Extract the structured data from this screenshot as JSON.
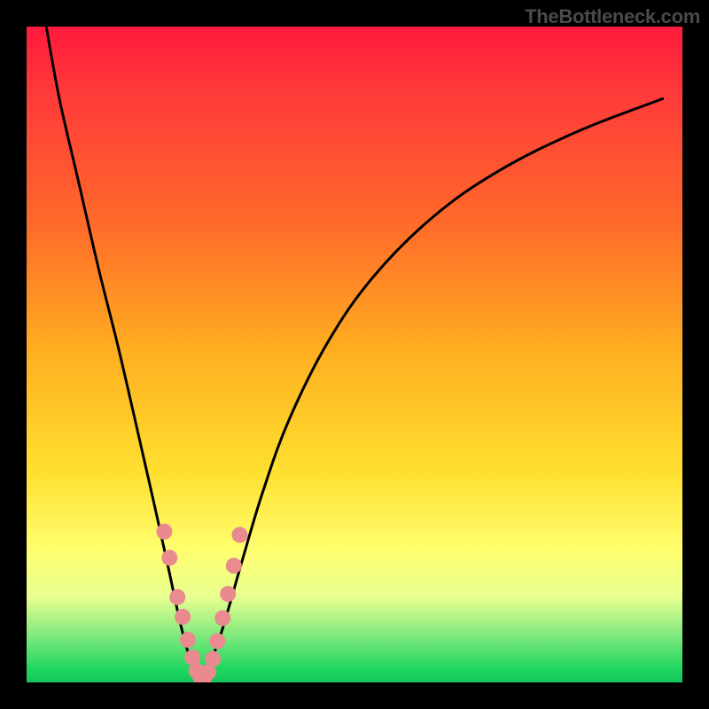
{
  "watermark": "TheBottleneck.com",
  "chart_data": {
    "type": "line",
    "title": "",
    "xlabel": "",
    "ylabel": "",
    "xlim": [
      0,
      100
    ],
    "ylim": [
      0,
      100
    ],
    "grid": false,
    "legend": false,
    "series": [
      {
        "name": "left-branch",
        "x": [
          3,
          5,
          8,
          11,
          14,
          17,
          19.5,
          21.5,
          23,
          24.2,
          25.2,
          26
        ],
        "y": [
          100,
          89,
          76,
          63,
          51,
          38,
          27,
          18,
          11,
          6,
          3,
          1
        ]
      },
      {
        "name": "right-branch",
        "x": [
          27,
          28,
          29.5,
          31,
          33,
          36,
          40,
          46,
          53,
          62,
          72,
          84,
          97
        ],
        "y": [
          1,
          3,
          7,
          12,
          19,
          29,
          40,
          52,
          62,
          71,
          78,
          84,
          89
        ]
      }
    ],
    "scatter_overlay": {
      "name": "highlight-dots",
      "color": "#e98a8f",
      "radius_px": 9,
      "points": [
        {
          "x": 21.0,
          "y": 23
        },
        {
          "x": 21.8,
          "y": 19
        },
        {
          "x": 23.0,
          "y": 13
        },
        {
          "x": 23.8,
          "y": 10
        },
        {
          "x": 24.6,
          "y": 6.5
        },
        {
          "x": 25.3,
          "y": 3.8
        },
        {
          "x": 25.9,
          "y": 1.8
        },
        {
          "x": 26.5,
          "y": 0.8
        },
        {
          "x": 27.1,
          "y": 0.8
        },
        {
          "x": 27.7,
          "y": 1.6
        },
        {
          "x": 28.4,
          "y": 3.6
        },
        {
          "x": 29.1,
          "y": 6.3
        },
        {
          "x": 29.9,
          "y": 9.8
        },
        {
          "x": 30.7,
          "y": 13.5
        },
        {
          "x": 31.6,
          "y": 17.8
        },
        {
          "x": 32.5,
          "y": 22.5
        }
      ]
    },
    "background_gradient": {
      "top": "#ff1a3c",
      "upper_mid": "#ffb020",
      "lower_mid": "#ffff70",
      "bottom": "#14c45a"
    }
  }
}
